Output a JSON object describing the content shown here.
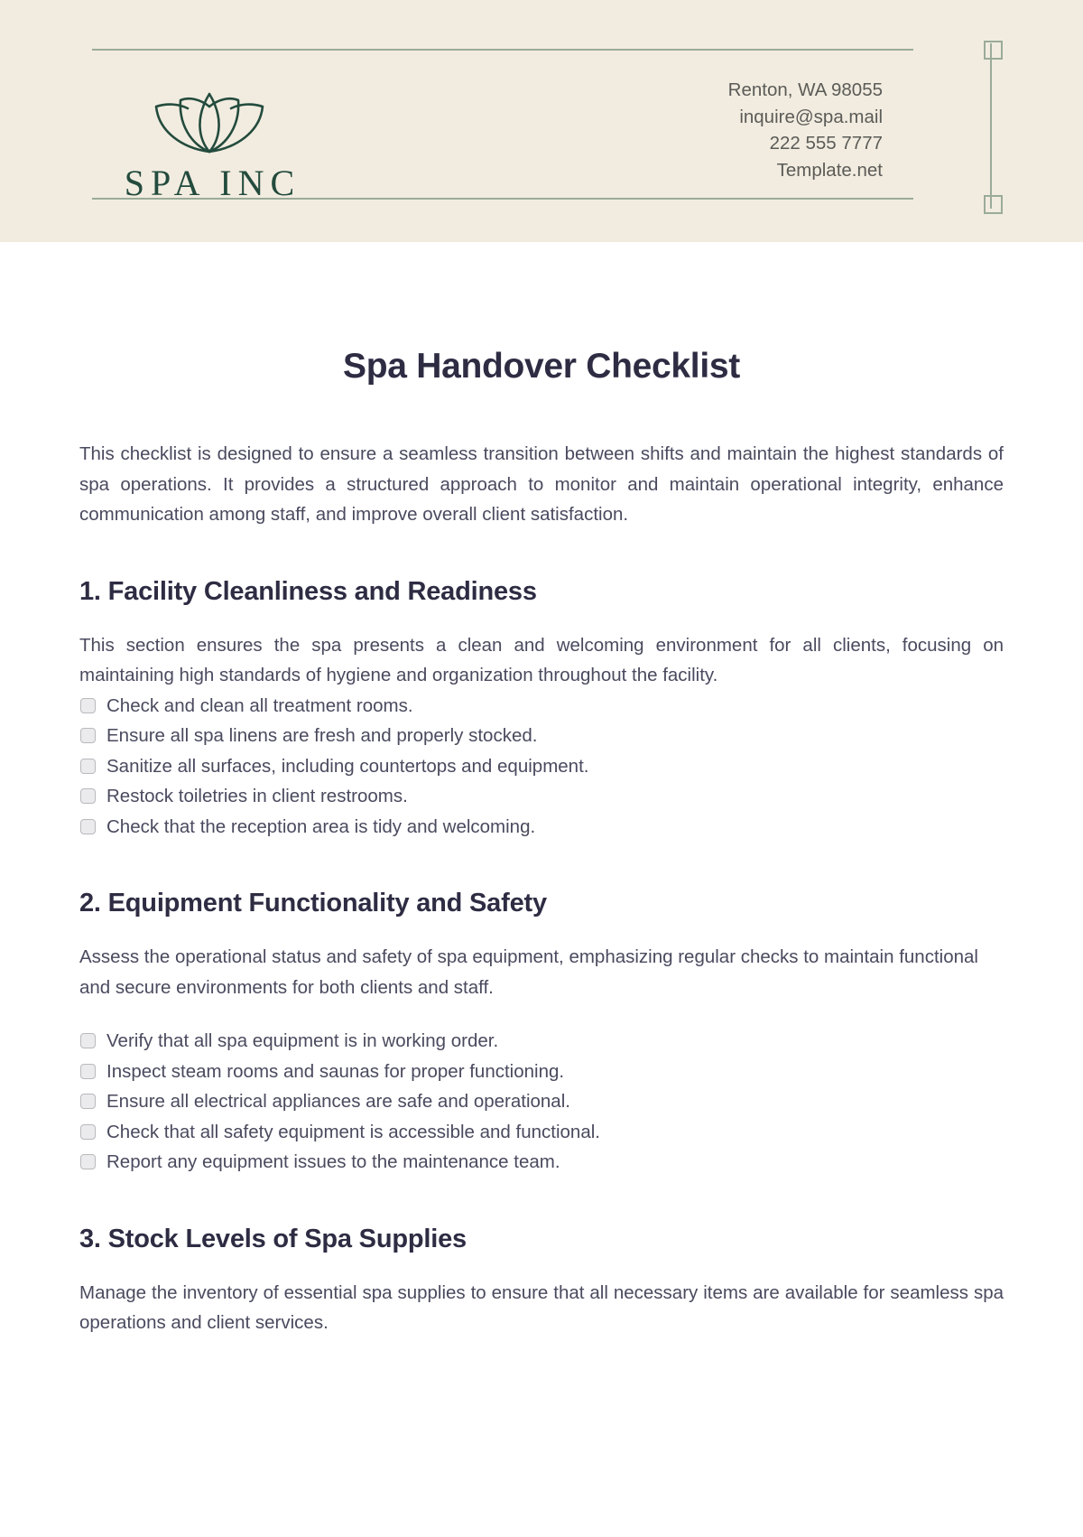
{
  "header": {
    "logo": {
      "icon": "lotus-flower-icon",
      "wordmark": "SPA INC"
    },
    "contact": [
      "Renton, WA 98055",
      "inquire@spa.mail",
      "222 555 7777",
      "Template.net"
    ],
    "colors": {
      "band_background": "#f2ece0",
      "rule": "#9aab99",
      "logo_green": "#234b3d",
      "contact_text": "#5b5b57"
    }
  },
  "document": {
    "title": "Spa Handover Checklist",
    "intro": "This checklist is designed to ensure a seamless transition between shifts and maintain the highest standards of spa operations. It provides a structured approach to monitor and maintain operational integrity, enhance communication among staff, and improve overall client satisfaction.",
    "colors": {
      "heading_text": "#2e2c43",
      "body_text": "#4a4a5f",
      "checkbox_fill": "#ebebee",
      "checkbox_border": "#b9b9bd"
    },
    "sections": [
      {
        "heading": "1. Facility Cleanliness and Readiness",
        "description": "This section ensures the spa presents a clean and welcoming environment for all clients, focusing on maintaining high standards of hygiene and organization throughout the facility.",
        "items": [
          "Check and clean all treatment rooms.",
          "Ensure all spa linens are fresh and properly stocked.",
          "Sanitize all surfaces, including countertops and equipment.",
          "Restock toiletries in client restrooms.",
          "Check that the reception area is tidy and welcoming."
        ]
      },
      {
        "heading": "2. Equipment Functionality and Safety",
        "description": "Assess the operational status and safety of spa equipment, emphasizing regular checks to maintain functional and secure environments for both clients and staff.",
        "items": [
          "Verify that all spa equipment is in working order.",
          "Inspect steam rooms and saunas for proper functioning.",
          "Ensure all electrical appliances are safe and operational.",
          "Check that all safety equipment is accessible and functional.",
          "Report any equipment issues to the maintenance team."
        ]
      },
      {
        "heading": "3. Stock Levels of Spa Supplies",
        "description": "Manage the inventory of essential spa supplies to ensure that all necessary items are available for seamless spa operations and client services.",
        "items": []
      }
    ]
  }
}
